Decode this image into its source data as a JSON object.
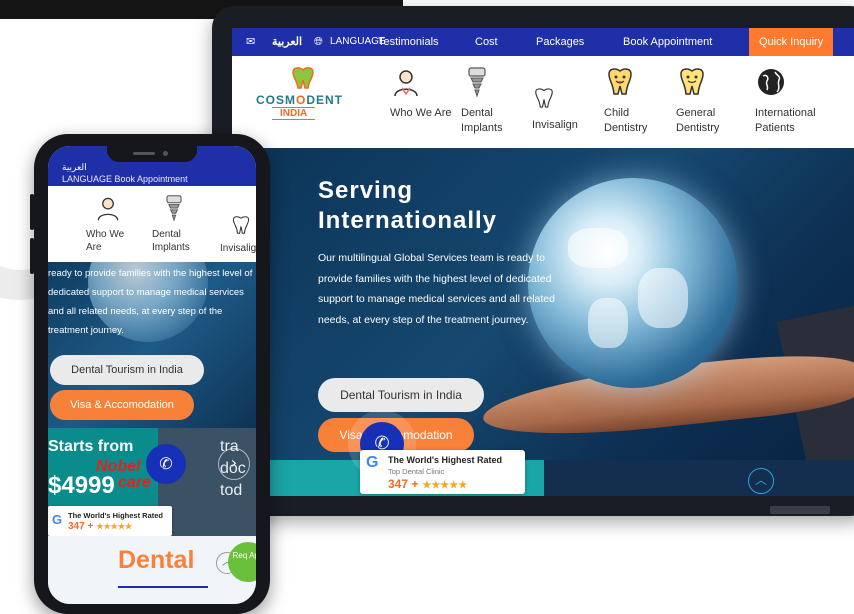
{
  "laptop": {
    "nav": {
      "arabic": "العربية",
      "language": "LANGUAGE",
      "links": [
        "Testimonials",
        "Cost",
        "Packages",
        "Book Appointment"
      ],
      "quick_inquiry": "Quick Inquiry"
    },
    "logo": {
      "word": "COSM",
      "o": "O",
      "rest": "DENT",
      "sub": "INDIA"
    },
    "menu": [
      {
        "label": "Who We Are",
        "icon": "doctor-icon"
      },
      {
        "label": "Dental Implants",
        "icon": "implant-icon"
      },
      {
        "label": "Invisalign",
        "icon": "aligner-icon"
      },
      {
        "label": "Child Dentistry",
        "icon": "child-tooth-icon"
      },
      {
        "label": "General Dentistry",
        "icon": "tooth-icon"
      },
      {
        "label": "International Patients",
        "icon": "globe-icon"
      }
    ],
    "hero": {
      "title_line1": "Serving",
      "title_line2": "Internationally",
      "text": "Our multilingual Global Services team is ready to provide families with the highest level of dedicated support to manage medical services and all related needs, at every step of the treatment journey.",
      "btn_primary": "Dental Tourism in India",
      "btn_secondary": "Visa & Accomodation"
    },
    "badge": {
      "title": "The World's Highest Rated",
      "subtitle": "Top Dental Clinic",
      "count": "347 +",
      "stars": "★★★★★"
    }
  },
  "phone": {
    "nav": {
      "arabic": "العربية",
      "language": "LANGUAGE",
      "book": "Book Appointment"
    },
    "menu": [
      {
        "label": "Who We Are"
      },
      {
        "label": "Dental Implants"
      },
      {
        "label": "Invisalign"
      }
    ],
    "hero_text": "ready to provide families with the highest level of dedicated support to manage medical services and all related needs, at every step of the treatment journey.",
    "btn_primary": "Dental Tourism in India",
    "btn_secondary": "Visa & Accomodation",
    "promo": {
      "starts": "Starts from",
      "price": "$4999",
      "brand1": "Nobel",
      "brand2": "care",
      "side": "tra doc tod"
    },
    "badge": {
      "title": "The World's Highest Rated",
      "count": "347 +",
      "stars": "★★★★★"
    },
    "bottom_title": "Dental",
    "request": "Req App"
  },
  "colors": {
    "nav_blue": "#1f2fa8",
    "accent_orange": "#f8813a",
    "brand_teal": "#1f7a8c"
  }
}
